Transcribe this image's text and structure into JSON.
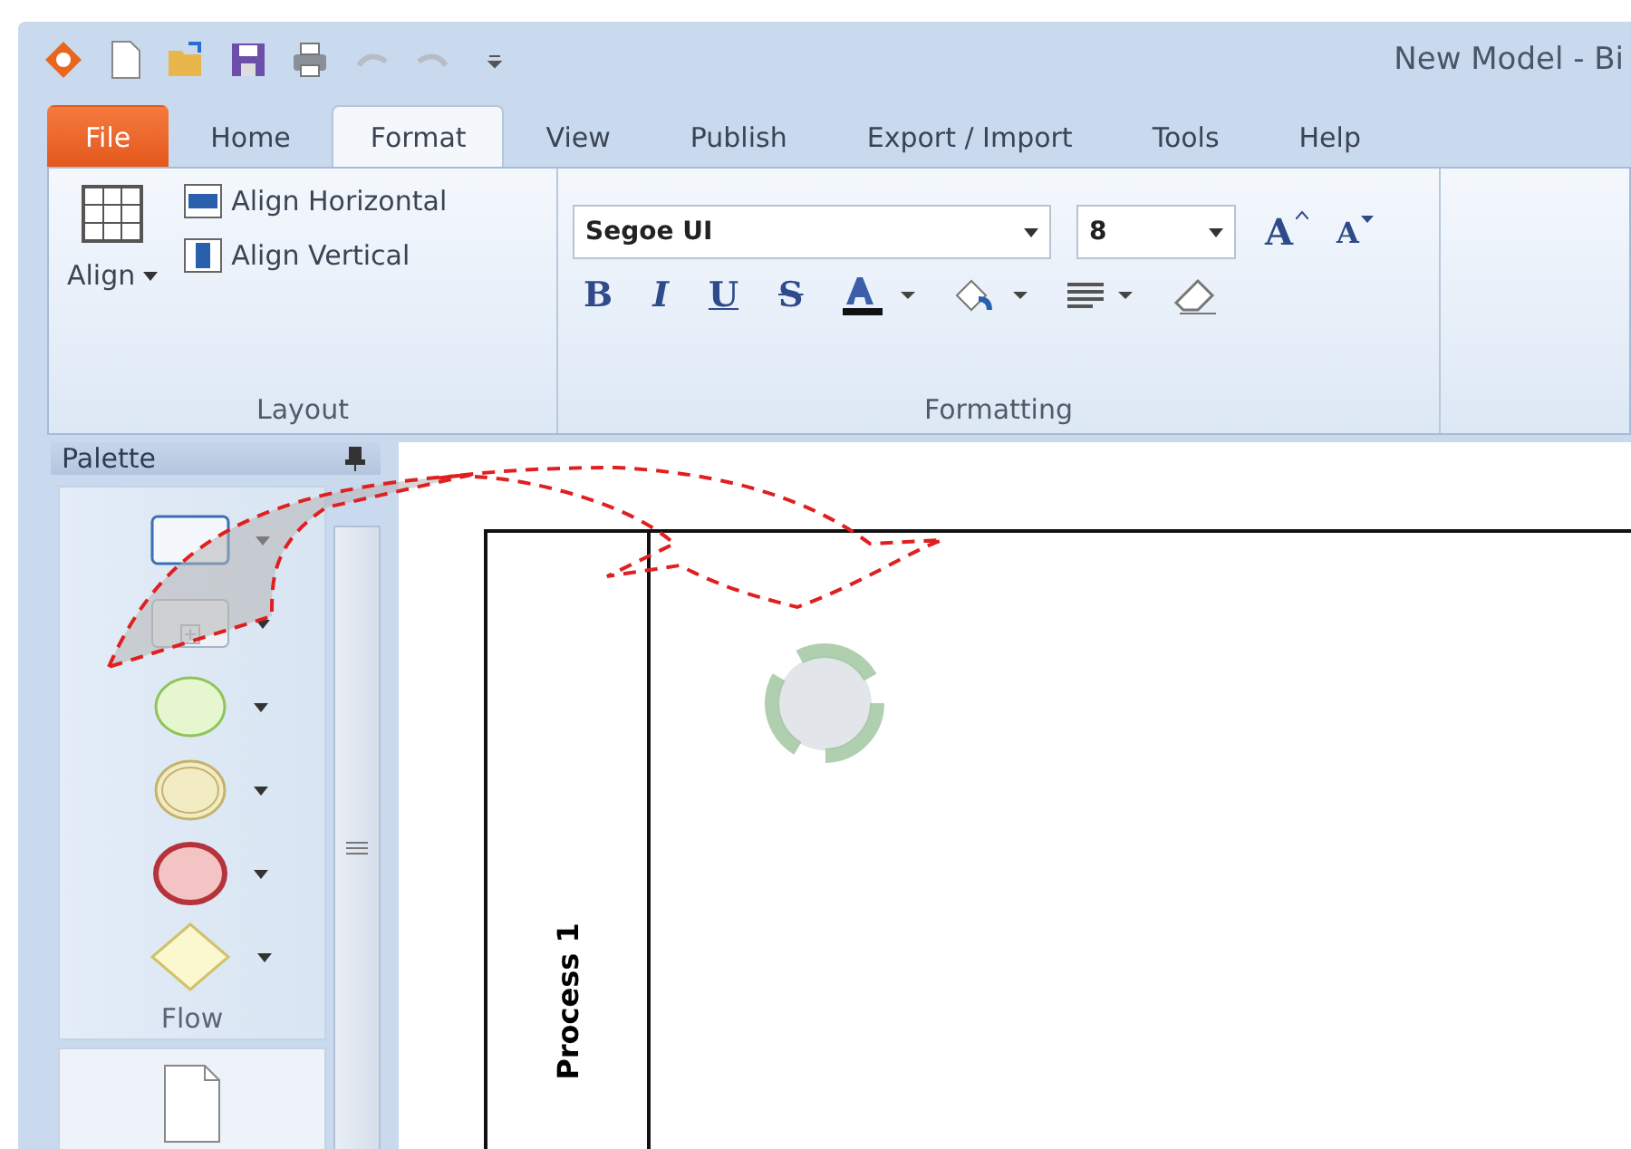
{
  "window": {
    "title": "New Model - Bi"
  },
  "tabs": [
    {
      "label": "File",
      "kind": "file",
      "selected": false
    },
    {
      "label": "Home",
      "kind": "tab",
      "selected": false
    },
    {
      "label": "Format",
      "kind": "tab",
      "selected": true
    },
    {
      "label": "View",
      "kind": "tab",
      "selected": false
    },
    {
      "label": "Publish",
      "kind": "tab",
      "selected": false
    },
    {
      "label": "Export / Import",
      "kind": "tab",
      "selected": false
    },
    {
      "label": "Tools",
      "kind": "tab",
      "selected": false
    },
    {
      "label": "Help",
      "kind": "tab",
      "selected": false
    }
  ],
  "layout_group": {
    "label": "Layout",
    "align_button": "Align",
    "align_horizontal": "Align Horizontal",
    "align_vertical": "Align Vertical"
  },
  "formatting_group": {
    "label": "Formatting",
    "font": "Segoe UI",
    "size": "8",
    "bold": "B",
    "italic": "I",
    "underline": "U",
    "strike": "S",
    "grow_font": "A",
    "shrink_font": "A"
  },
  "palette": {
    "title": "Palette",
    "items": [
      {
        "kind": "task"
      },
      {
        "kind": "subprocess"
      },
      {
        "kind": "start"
      },
      {
        "kind": "intermediate"
      },
      {
        "kind": "end"
      },
      {
        "kind": "gateway"
      }
    ],
    "section": "Flow"
  },
  "canvas": {
    "lane_label": "Process 1"
  }
}
